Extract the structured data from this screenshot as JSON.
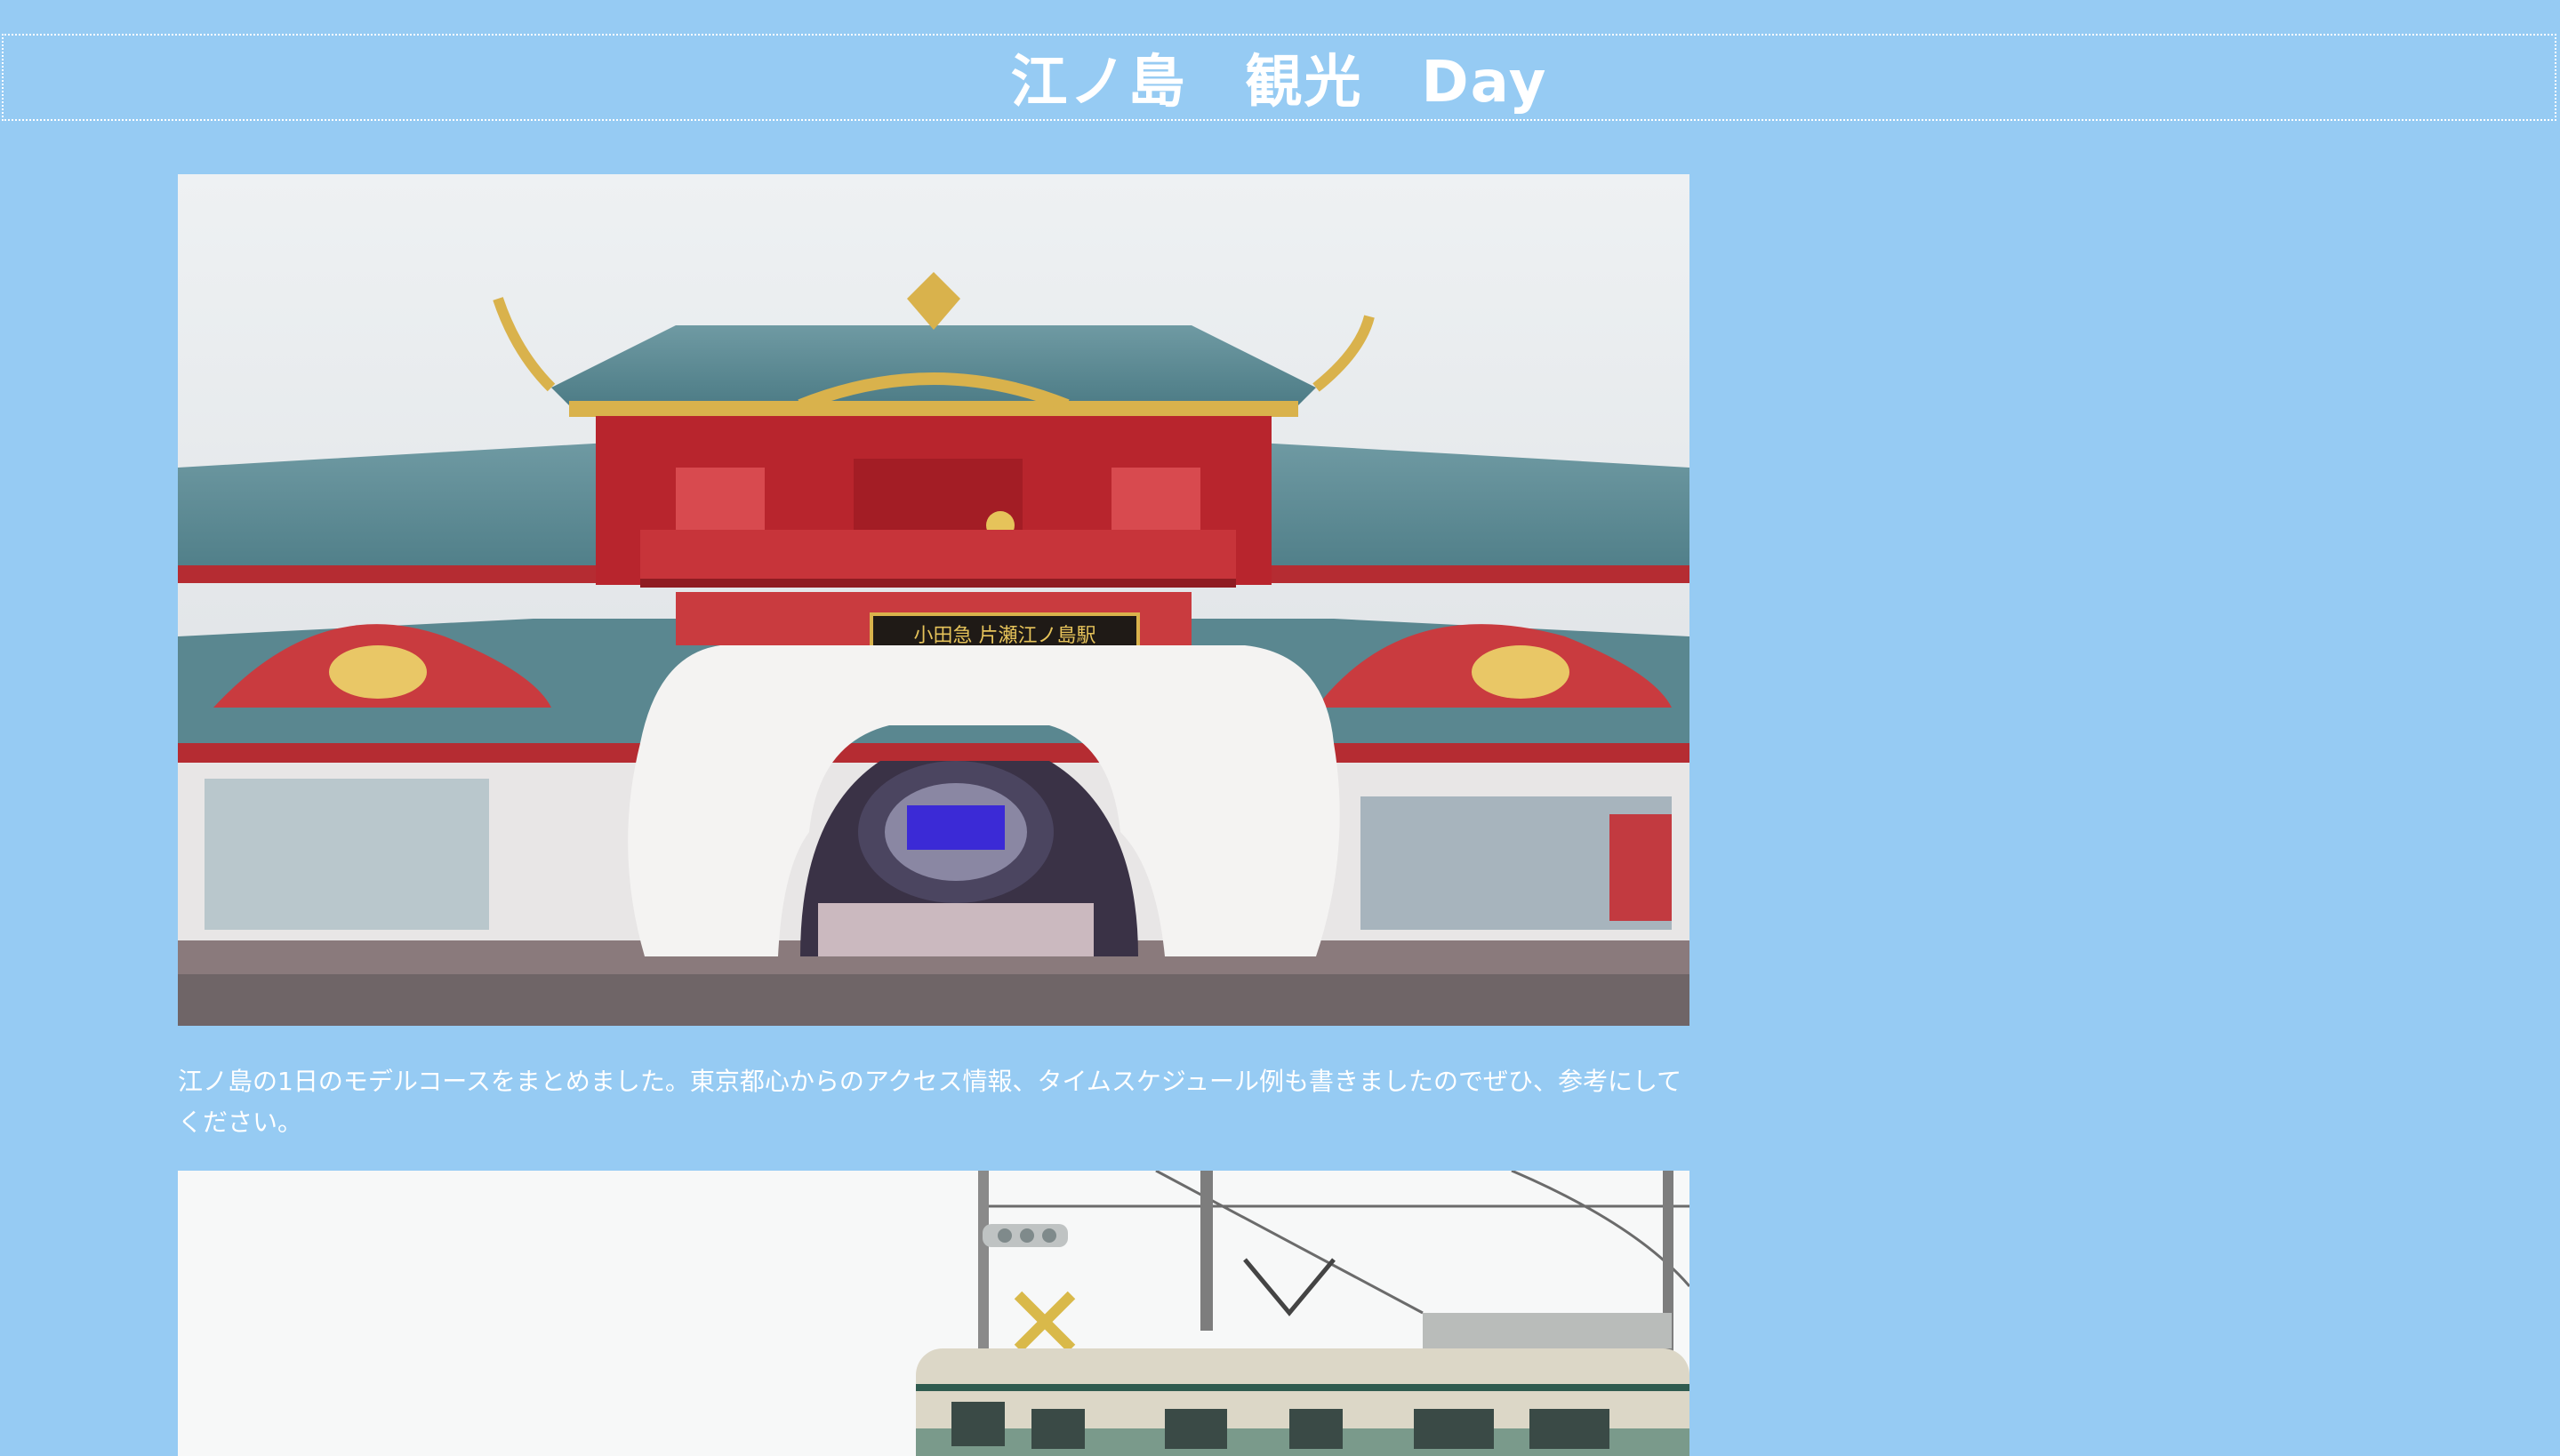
{
  "header": {
    "title": "江ノ島　観光　Day"
  },
  "main": {
    "hero_image": {
      "icon": "station-photo",
      "sign_text": "小田急 片瀬江ノ島駅"
    },
    "intro": "江ノ島の1日のモデルコースをまとめました。東京都心からのアクセス情報、タイムスケジュール例も書きましたのでぜひ、参考にしてください。",
    "second_image": {
      "icon": "tram-photo"
    }
  },
  "colors": {
    "background": "#96cbf3",
    "text": "#ffffff"
  }
}
